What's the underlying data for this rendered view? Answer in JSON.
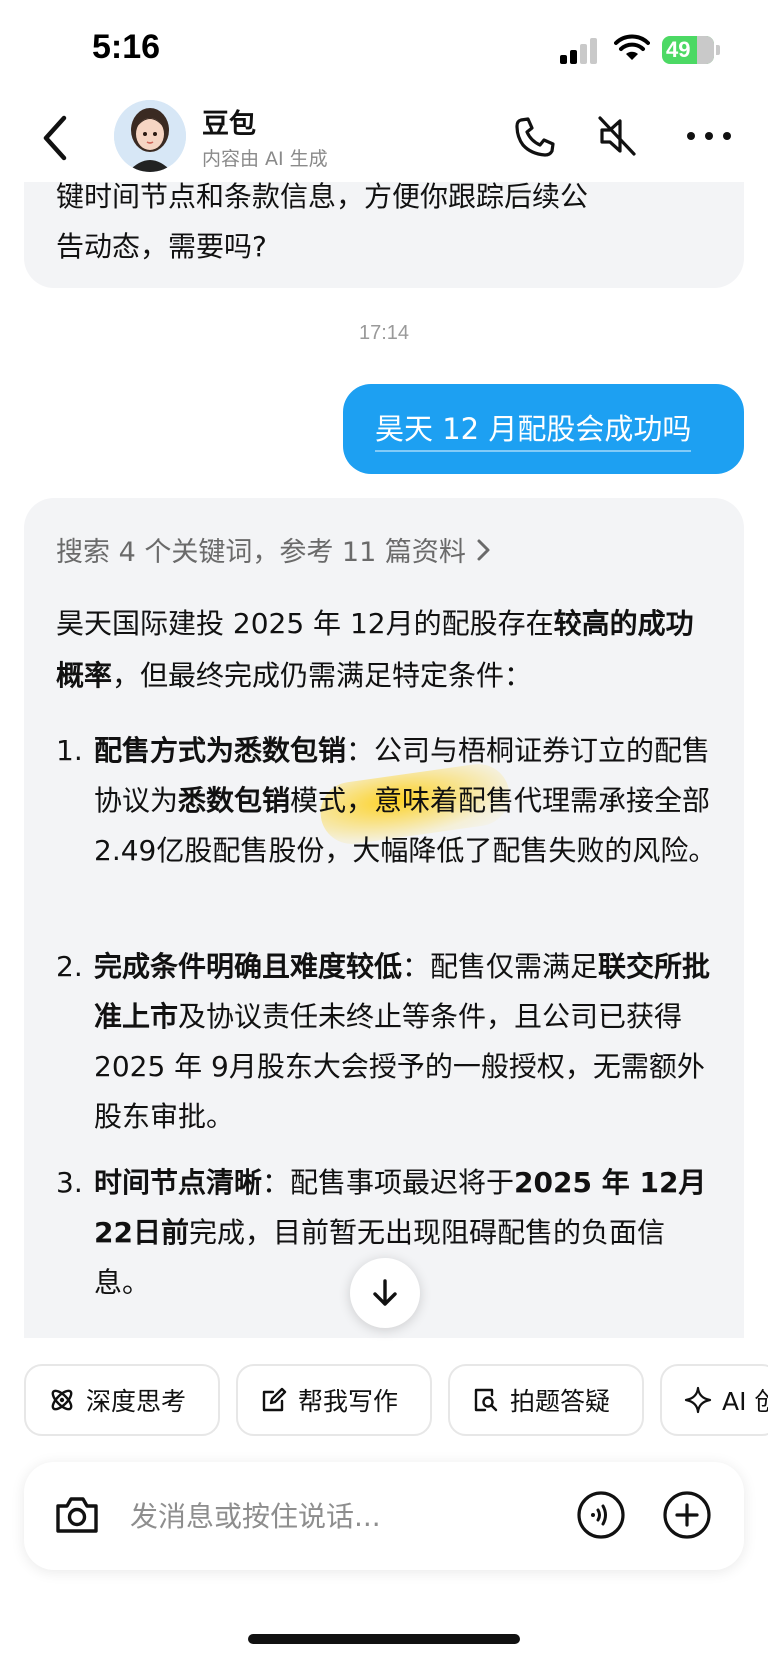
{
  "status_bar": {
    "time": "5:16",
    "battery": "49"
  },
  "header": {
    "name": "豆包",
    "subtitle": "内容由 AI 生成"
  },
  "previous_message": {
    "line1": "键时间节点和条款信息，方便你跟踪后续公",
    "line2": "告动态，需要吗?"
  },
  "timestamp": "17:14",
  "user_message": "昊天 12 月配股会成功吗",
  "answer": {
    "search_summary": "搜索 4 个关键词，参考 11 篇资料",
    "intro_a": "昊天国际建投 2025 年 12月的配股存在",
    "intro_bold": "较高的成功概率",
    "intro_b": "，但最终完成仍需满足特定条件：",
    "items": [
      {
        "num": "1.",
        "title": "配售方式为悉数包销",
        "t1": "：公司与梧桐证券订立的配售协议为",
        "bold2": "悉数包销",
        "t2": "模式，意味着配售代理需承接全部 2.49亿股配售股份，大幅降低了配售失败的风险。"
      },
      {
        "num": "2.",
        "title": "完成条件明确且难度较低",
        "t1": "：配售仅需满足",
        "bold2": "联交所批准上市",
        "t2": "及协议责任未终止等条件，且公司已获得 2025 年 9月股东大会授予的一般授权，无需额外股东审批。"
      },
      {
        "num": "3.",
        "title": "时间节点清晰",
        "t1": "：配售事项最迟将于",
        "bold2": "2025 年 12月22日前",
        "t2": "完成，目前暂无出现阻碍配售的负面信息。"
      }
    ]
  },
  "quick_actions": [
    {
      "icon": "atom-icon",
      "label": "深度思考"
    },
    {
      "icon": "edit-icon",
      "label": "帮我写作"
    },
    {
      "icon": "photo-search-icon",
      "label": "拍题答疑"
    },
    {
      "icon": "sparkle-icon",
      "label": "AI 创"
    }
  ],
  "composer": {
    "placeholder": "发消息或按住说话..."
  },
  "colors": {
    "accent_blue": "#1da0f2",
    "bubble_gray": "#f3f4f6",
    "battery_green": "#4cd964"
  }
}
